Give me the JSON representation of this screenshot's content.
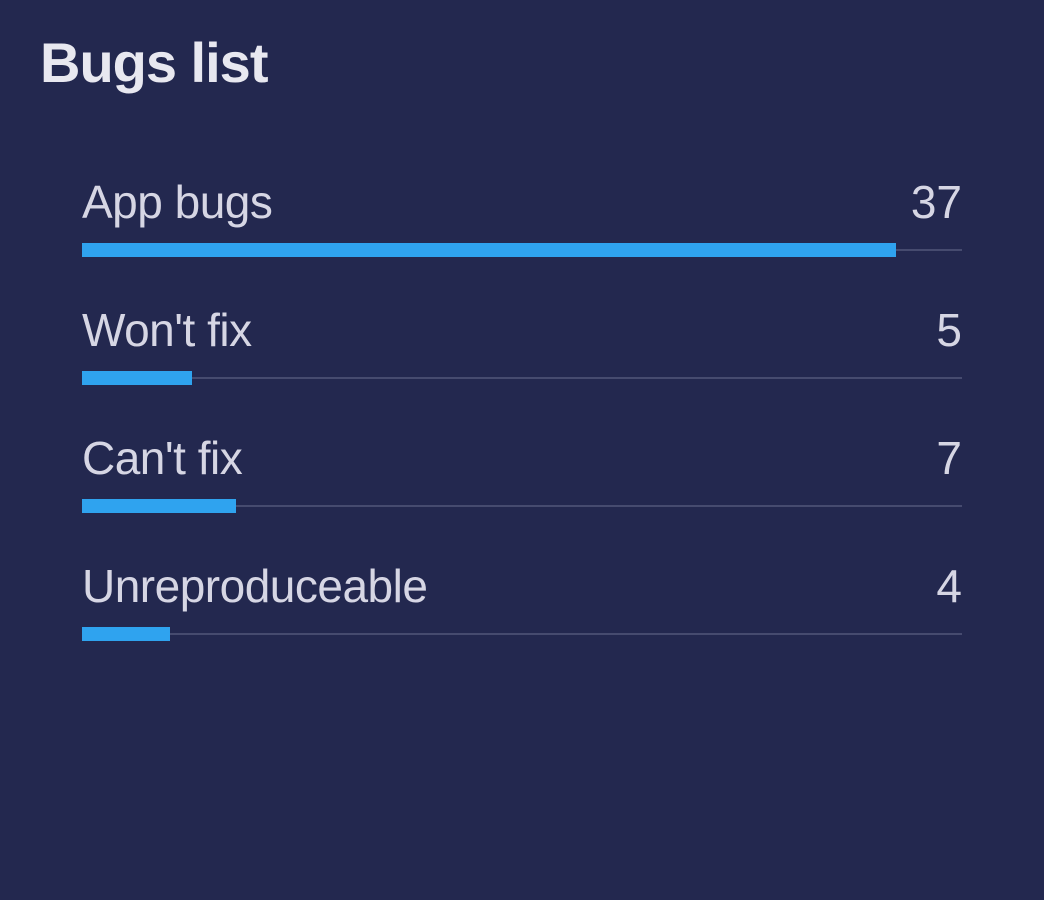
{
  "title": "Bugs list",
  "items": [
    {
      "label": "App bugs",
      "value": 37
    },
    {
      "label": "Won't fix",
      "value": 5
    },
    {
      "label": "Can't fix",
      "value": 7
    },
    {
      "label": "Unreproduceable",
      "value": 4
    }
  ],
  "colors": {
    "background": "#23284f",
    "bar": "#2fa3ef",
    "text": "#d6d6e4",
    "track": "#6a6e8f"
  },
  "chart_data": {
    "type": "bar",
    "title": "Bugs list",
    "categories": [
      "App bugs",
      "Won't fix",
      "Can't fix",
      "Unreproduceable"
    ],
    "values": [
      37,
      5,
      7,
      4
    ],
    "xlabel": "",
    "ylabel": "",
    "ylim": [
      0,
      40
    ]
  }
}
